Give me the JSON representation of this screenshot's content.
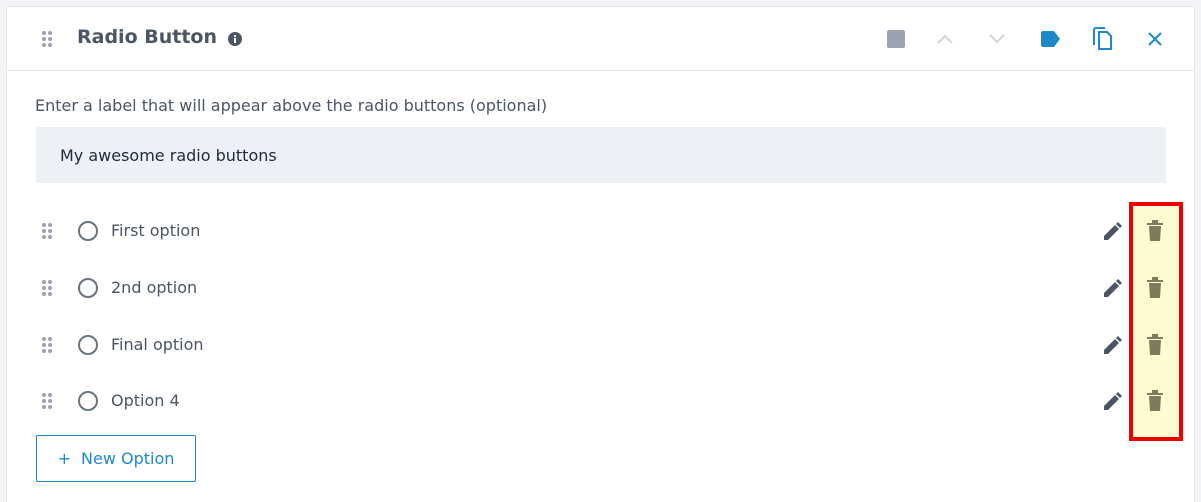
{
  "header": {
    "title": "Radio Button",
    "icons": [
      "drag-handle-icon",
      "info-icon",
      "stop-icon",
      "chevron-up-icon",
      "chevron-down-icon",
      "tag-icon",
      "duplicate-icon",
      "close-icon"
    ]
  },
  "label_field": {
    "prompt": "Enter a label that will appear above the radio buttons (optional)",
    "value": "My awesome radio buttons"
  },
  "options": [
    {
      "label": "First option"
    },
    {
      "label": "2nd option"
    },
    {
      "label": "Final option"
    },
    {
      "label": "Option 4"
    }
  ],
  "new_option_button": {
    "plus": "+",
    "label": "New Option"
  },
  "colors": {
    "accent": "#1e88c9",
    "text": "#4b5563",
    "input_bg": "#edf0f4",
    "delete_icon": "#7c7c5c",
    "highlight_border": "#ee0000",
    "highlight_fill": "#fdfbd2"
  }
}
